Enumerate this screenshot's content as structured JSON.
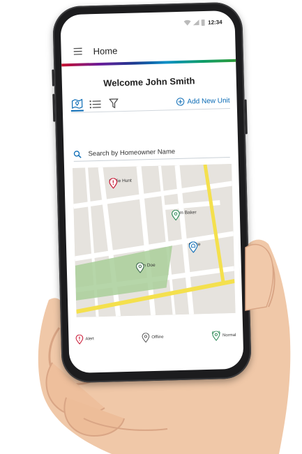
{
  "status_bar": {
    "time": "12:34"
  },
  "header": {
    "title": "Home"
  },
  "welcome": {
    "text": "Welcome John Smith"
  },
  "toolbar": {
    "add_unit_label": "Add New Unit"
  },
  "search": {
    "placeholder": "Search by Homeowner Name"
  },
  "map": {
    "pins": [
      {
        "label": "Leslie Hunt",
        "status": "alert"
      },
      {
        "label": "Adam Baker",
        "status": "normal"
      },
      {
        "label": "Office",
        "status": "office"
      },
      {
        "label": "John Doe",
        "status": "offline"
      }
    ]
  },
  "legend": {
    "alert": "Alert",
    "offline": "Offline",
    "normal": "Normal"
  },
  "colors": {
    "accent": "#0a6bb5",
    "alert": "#c8102e",
    "normal": "#2e8b57",
    "offline": "#3f6b4f"
  }
}
